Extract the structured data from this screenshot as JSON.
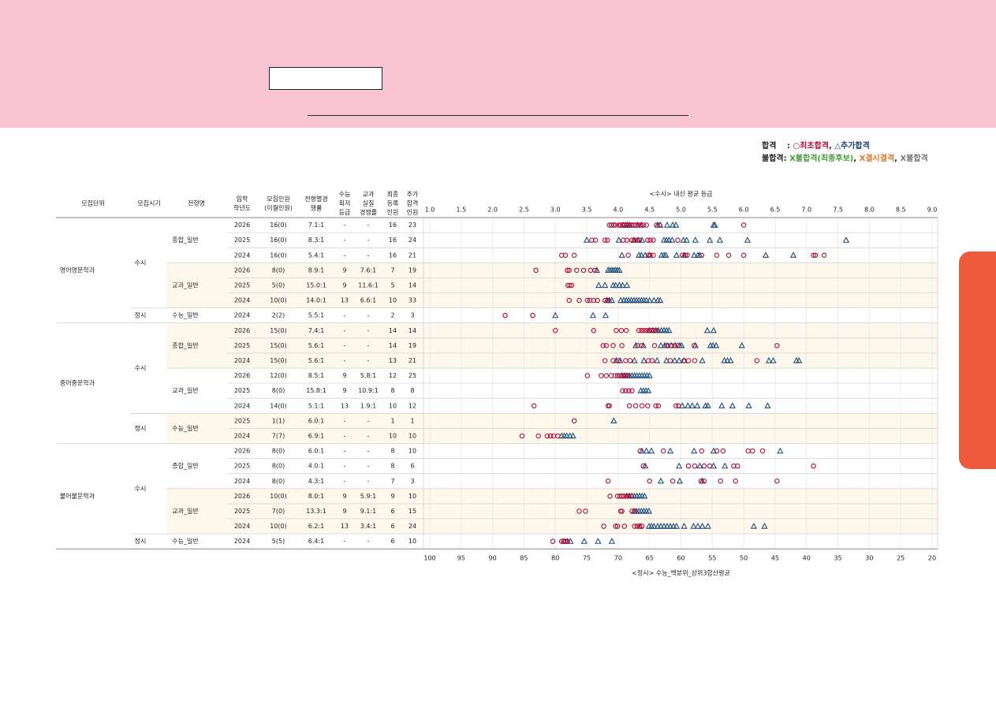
{
  "legend": {
    "pass_label": "합격",
    "pass_sep": ":",
    "pass_first": "○최초합격",
    "pass_comma": ",",
    "pass_additional": "△추가합격",
    "fail_label": "불합격:",
    "fail_green": "X불합격(최종후보)",
    "fail_orange": "X결시결격",
    "fail_gray": "X불합격",
    "colors": {
      "first": "#b0103a",
      "additional": "#1d4f7e",
      "green": "#4a9a3d",
      "orange": "#e2782c",
      "gray": "#7a7a7a"
    }
  },
  "headers": {
    "unit": "모집단위",
    "period": "모집시기",
    "type": "전형명",
    "year": [
      "입학",
      "학년도"
    ],
    "quota": [
      "모집인원",
      "(이월인원)"
    ],
    "competition": [
      "전형별경",
      "쟁률"
    ],
    "csat_min": [
      "수능",
      "최저",
      "등급"
    ],
    "subject_comp": [
      "교과",
      "실질",
      "경쟁률"
    ],
    "final": [
      "최종",
      "등록",
      "인원"
    ],
    "additional": [
      "추가",
      "합격",
      "인원"
    ]
  },
  "chart_data": {
    "type": "scatter",
    "title": "",
    "top_axis_label": "<수시> 내신 평균 등급",
    "bottom_axis_label": "<정시> 수능_백분위_상위3합산평균",
    "top_axis_ticks": [
      "1.0",
      "1.5",
      "2.0",
      "2.5",
      "3.0",
      "3.5",
      "4.0",
      "4.5",
      "5.0",
      "5.5",
      "6.0",
      "6.5",
      "7.0",
      "7.5",
      "8.0",
      "8.5",
      "9.0"
    ],
    "bottom_axis_ticks": [
      "100",
      "95",
      "90",
      "85",
      "80",
      "75",
      "70",
      "65",
      "60",
      "55",
      "50",
      "45",
      "40",
      "35",
      "30",
      "25",
      "20"
    ],
    "xlim_grade": [
      1.0,
      9.0
    ],
    "xlim_percentile": [
      100,
      20
    ],
    "departments": [
      {
        "name": "영어영문학과",
        "rows": [
          0,
          6
        ]
      },
      {
        "name": "중어중문학과",
        "rows": [
          7,
          14
        ]
      },
      {
        "name": "불어불문학과",
        "rows": [
          15,
          21
        ]
      }
    ],
    "periods": [
      {
        "label": "수시",
        "rows": [
          0,
          5
        ]
      },
      {
        "label": "정시",
        "rows": [
          6,
          6
        ]
      },
      {
        "label": "수시",
        "rows": [
          7,
          12
        ]
      },
      {
        "label": "정시",
        "rows": [
          13,
          14
        ]
      },
      {
        "label": "수시",
        "rows": [
          15,
          20
        ]
      },
      {
        "label": "정시",
        "rows": [
          21,
          21
        ]
      }
    ],
    "types": [
      {
        "label": "종합_일반",
        "rows": [
          0,
          2
        ],
        "shade": false
      },
      {
        "label": "교과_일반",
        "rows": [
          3,
          5
        ],
        "shade": true
      },
      {
        "label": "수능_일반",
        "rows": [
          6,
          6
        ],
        "shade": false
      },
      {
        "label": "종합_일반",
        "rows": [
          7,
          9
        ],
        "shade": true
      },
      {
        "label": "교과_일반",
        "rows": [
          10,
          12
        ],
        "shade": false
      },
      {
        "label": "수능_일반",
        "rows": [
          13,
          14
        ],
        "shade": true
      },
      {
        "label": "종합_일반",
        "rows": [
          15,
          17
        ],
        "shade": false
      },
      {
        "label": "교과_일반",
        "rows": [
          18,
          20
        ],
        "shade": true
      },
      {
        "label": "수능_일반",
        "rows": [
          21,
          21
        ],
        "shade": false
      }
    ],
    "rows": [
      {
        "year": "2026",
        "quota": "16(0)",
        "comp": "7.1:1",
        "csat": "-",
        "subj": "-",
        "final": "16",
        "add": "23",
        "scale": "grade",
        "first": [
          3.86,
          3.89,
          3.93,
          3.96,
          4.01,
          4.04,
          4.07,
          4.1,
          4.13,
          4.16,
          4.19,
          4.22,
          4.25,
          4.28,
          4.32,
          4.36,
          4.4,
          4.45,
          4.61,
          4.66,
          6.0
        ],
        "additional": [
          4.08,
          4.12,
          4.15,
          4.18,
          4.31,
          4.37,
          4.63,
          4.67,
          4.78,
          4.87,
          4.92,
          5.52,
          5.54
        ]
      },
      {
        "year": "2025",
        "quota": "16(0)",
        "comp": "8.3:1",
        "csat": "-",
        "subj": "-",
        "final": "16",
        "add": "24",
        "scale": "grade",
        "first": [
          3.58,
          3.64,
          3.79,
          3.83,
          4.08,
          4.14,
          4.22,
          4.26,
          4.3,
          4.34,
          4.47,
          4.51,
          4.56,
          4.95
        ],
        "additional": [
          3.5,
          4.01,
          4.25,
          4.32,
          4.38,
          4.73,
          4.77,
          4.81,
          4.86,
          5.04,
          5.09,
          5.23,
          5.46,
          5.62,
          6.06,
          7.63
        ]
      },
      {
        "year": "2024",
        "quota": "16(0)",
        "comp": "5.4:1",
        "csat": "-",
        "subj": "-",
        "final": "16",
        "add": "21",
        "scale": "grade",
        "first": [
          3.1,
          3.16,
          3.3,
          4.16,
          4.48,
          4.51,
          4.56,
          5.02,
          5.07,
          5.1,
          5.33,
          5.57,
          5.76,
          6.0,
          7.11,
          7.14,
          7.28
        ],
        "additional": [
          4.06,
          4.33,
          4.37,
          4.43,
          4.5,
          4.69,
          4.73,
          4.76,
          4.93,
          5.05,
          5.21,
          5.27,
          5.3,
          6.35,
          6.79
        ]
      },
      {
        "year": "2026",
        "quota": "8(0)",
        "comp": "8.9:1",
        "csat": "9",
        "subj": "7.6:1",
        "final": "7",
        "add": "19",
        "scale": "grade",
        "first": [
          2.69,
          3.19,
          3.22,
          3.34,
          3.45,
          3.56,
          3.63
        ],
        "additional": [
          3.66,
          3.84,
          3.87,
          3.9,
          3.93,
          3.96,
          3.99,
          4.02
        ]
      },
      {
        "year": "2025",
        "quota": "5(0)",
        "comp": "15.0:1",
        "csat": "9",
        "subj": "11.6:1",
        "final": "5",
        "add": "14",
        "scale": "grade",
        "first": [
          3.2,
          3.23,
          3.26
        ],
        "additional": [
          3.69,
          3.79,
          3.92,
          3.96,
          4.02,
          4.07,
          4.14
        ]
      },
      {
        "year": "2024",
        "quota": "10(0)",
        "comp": "14.0:1",
        "csat": "13",
        "subj": "6.6:1",
        "final": "10",
        "add": "33",
        "scale": "grade",
        "first": [
          3.22,
          3.38,
          3.51,
          3.55,
          3.61,
          3.67,
          3.79,
          3.83
        ],
        "additional": [
          3.82,
          3.86,
          3.9,
          4.04,
          4.09,
          4.13,
          4.17,
          4.21,
          4.25,
          4.29,
          4.33,
          4.37,
          4.41,
          4.45,
          4.5,
          4.57,
          4.63,
          4.67
        ]
      },
      {
        "year": "2024",
        "quota": "2(2)",
        "comp": "5.5:1",
        "csat": "-",
        "subj": "-",
        "final": "2",
        "add": "3",
        "scale": "percentile",
        "first": [
          88.0,
          83.6
        ],
        "additional": [
          80.0,
          74.0,
          72.0
        ]
      },
      {
        "year": "2026",
        "quota": "15(0)",
        "comp": "7.4:1",
        "csat": "-",
        "subj": "-",
        "final": "14",
        "add": "14",
        "scale": "grade",
        "first": [
          3.0,
          3.61,
          3.97,
          4.05,
          4.13,
          4.33,
          4.37,
          4.41,
          4.45,
          4.49,
          4.53,
          4.57,
          4.61
        ],
        "additional": [
          4.5,
          4.55,
          4.6,
          4.64,
          4.69,
          4.73,
          4.77,
          4.81,
          5.42,
          5.52
        ]
      },
      {
        "year": "2025",
        "quota": "15(0)",
        "comp": "5.6:1",
        "csat": "-",
        "subj": "-",
        "final": "14",
        "add": "19",
        "scale": "grade",
        "first": [
          3.76,
          3.81,
          3.92,
          4.06,
          4.31,
          4.37,
          4.58,
          4.77,
          4.84,
          4.9,
          4.95,
          5.21,
          6.53
        ],
        "additional": [
          4.28,
          4.4,
          4.68,
          4.74,
          4.79,
          4.85,
          4.91,
          4.98,
          5.01,
          5.23,
          5.47,
          5.51,
          5.56,
          5.97
        ]
      },
      {
        "year": "2024",
        "quota": "15(0)",
        "comp": "5.6:1",
        "csat": "-",
        "subj": "-",
        "final": "13",
        "add": "21",
        "scale": "grade",
        "first": [
          3.79,
          3.92,
          4.0,
          4.12,
          4.19,
          4.48,
          4.54,
          4.83,
          5.05,
          5.12,
          5.22,
          6.21
        ],
        "additional": [
          3.97,
          4.03,
          4.26,
          4.41,
          4.62,
          4.77,
          4.9,
          4.97,
          5.05,
          5.34,
          5.69,
          5.74,
          5.79,
          6.4,
          6.47,
          6.84,
          6.88
        ]
      },
      {
        "year": "2026",
        "quota": "12(0)",
        "comp": "8.5:1",
        "csat": "9",
        "subj": "5.8:1",
        "final": "12",
        "add": "25",
        "scale": "grade",
        "first": [
          3.51,
          3.73,
          3.81,
          3.89,
          3.95,
          3.99,
          4.03,
          4.07,
          4.11,
          4.15
        ],
        "additional": [
          4.06,
          4.1,
          4.14,
          4.18,
          4.22,
          4.26,
          4.3,
          4.34,
          4.38,
          4.42,
          4.46,
          4.5
        ]
      },
      {
        "year": "2025",
        "quota": "8(0)",
        "comp": "15.8:1",
        "csat": "9",
        "subj": "10.9:1",
        "final": "8",
        "add": "8",
        "scale": "grade",
        "first": [
          4.07,
          4.12,
          4.17,
          4.22
        ],
        "additional": [
          4.36,
          4.4,
          4.44,
          4.48
        ]
      },
      {
        "year": "2024",
        "quota": "14(0)",
        "comp": "5.1:1",
        "csat": "13",
        "subj": "1.9:1",
        "final": "10",
        "add": "12",
        "scale": "grade",
        "first": [
          2.66,
          3.84,
          3.86,
          4.18,
          4.28,
          4.38,
          4.47,
          4.6,
          4.64,
          4.92,
          4.96
        ],
        "additional": [
          5.02,
          5.11,
          5.18,
          5.26,
          5.39,
          5.43,
          5.65,
          5.82,
          6.08,
          6.38
        ]
      },
      {
        "year": "2025",
        "quota": "1(1)",
        "comp": "6.0:1",
        "csat": "-",
        "subj": "-",
        "final": "1",
        "add": "1",
        "scale": "percentile",
        "first": [
          77.0
        ],
        "additional": [
          70.7
        ]
      },
      {
        "year": "2024",
        "quota": "7(7)",
        "comp": "6.9:1",
        "csat": "-",
        "subj": "-",
        "final": "10",
        "add": "10",
        "scale": "percentile",
        "first": [
          85.3,
          82.7,
          81.3,
          80.8,
          80.3,
          79.6
        ],
        "additional": [
          79.0,
          78.6,
          78.2,
          77.7,
          77.2
        ]
      },
      {
        "year": "2026",
        "quota": "8(0)",
        "comp": "6.0:1",
        "csat": "-",
        "subj": "-",
        "final": "8",
        "add": "10",
        "scale": "grade",
        "first": [
          4.35,
          4.72,
          5.33,
          5.57,
          5.67,
          6.07,
          6.14,
          6.3
        ],
        "additional": [
          4.38,
          4.45,
          4.53,
          4.83,
          5.21,
          5.52,
          6.58
        ]
      },
      {
        "year": "2025",
        "quota": "8(0)",
        "comp": "4.0:1",
        "csat": "-",
        "subj": "-",
        "final": "8",
        "add": "6",
        "scale": "grade",
        "first": [
          4.4,
          5.12,
          5.22,
          5.37,
          5.46,
          5.84,
          5.9,
          7.11
        ],
        "additional": [
          4.43,
          4.97,
          5.3,
          5.52,
          5.7
        ]
      },
      {
        "year": "2024",
        "quota": "8(0)",
        "comp": "4.3:1",
        "csat": "-",
        "subj": "-",
        "final": "7",
        "add": "3",
        "scale": "grade",
        "first": [
          3.84,
          4.5,
          4.87,
          5.32,
          5.37,
          5.63,
          5.87,
          6.53
        ],
        "additional": [
          4.68,
          4.98,
          5.34
        ]
      },
      {
        "year": "2026",
        "quota": "10(0)",
        "comp": "8.0:1",
        "csat": "9",
        "subj": "5.9:1",
        "final": "9",
        "add": "10",
        "scale": "grade",
        "first": [
          3.87,
          3.99,
          4.03,
          4.06,
          4.09,
          4.13,
          4.17,
          4.21
        ],
        "additional": [
          4.14,
          4.18,
          4.22,
          4.26,
          4.3,
          4.34,
          4.38,
          4.42
        ]
      },
      {
        "year": "2025",
        "quota": "7(0)",
        "comp": "13.3:1",
        "csat": "9",
        "subj": "9.1:1",
        "final": "6",
        "add": "15",
        "scale": "grade",
        "first": [
          3.38,
          3.48,
          4.04,
          4.06,
          4.22,
          4.26
        ],
        "additional": [
          4.25,
          4.29,
          4.33,
          4.37,
          4.41,
          4.45,
          4.49
        ]
      },
      {
        "year": "2024",
        "quota": "10(0)",
        "comp": "6.2:1",
        "csat": "13",
        "subj": "3.4:1",
        "final": "6",
        "add": "24",
        "scale": "grade",
        "first": [
          3.77,
          3.96,
          3.99,
          4.1,
          4.26,
          4.3,
          4.34,
          4.38
        ],
        "additional": [
          4.35,
          4.49,
          4.53,
          4.57,
          4.63,
          4.68,
          4.73,
          4.78,
          4.83,
          4.88,
          4.93,
          5.05,
          5.2,
          5.27,
          5.34,
          5.43,
          6.16,
          6.33
        ]
      },
      {
        "year": "2024",
        "quota": "5(5)",
        "comp": "6.4:1",
        "csat": "-",
        "subj": "-",
        "final": "6",
        "add": "10",
        "scale": "percentile",
        "first": [
          80.4,
          79.0,
          78.7,
          78.4,
          78.1
        ],
        "additional": [
          78.6,
          78.1,
          77.6,
          75.4,
          73.2,
          71.0
        ]
      }
    ]
  }
}
